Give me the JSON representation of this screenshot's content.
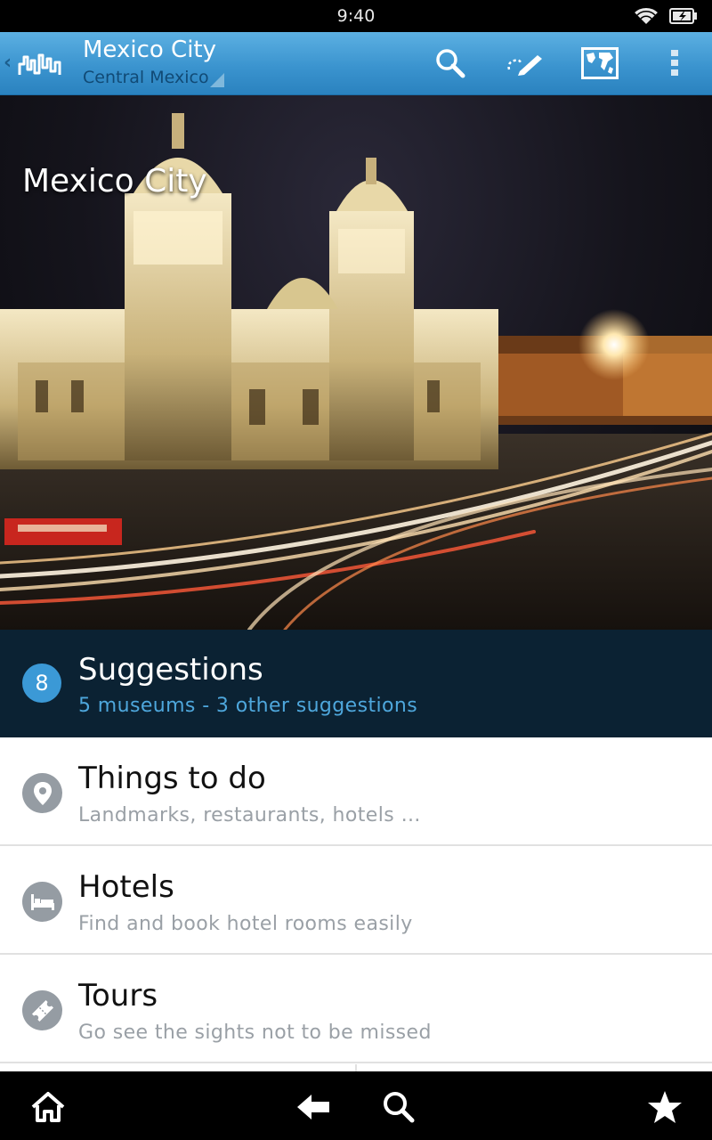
{
  "status_bar": {
    "time": "9:40"
  },
  "action_bar": {
    "title": "Mexico City",
    "subtitle": "Central Mexico",
    "icons": [
      "search-icon",
      "edit-icon",
      "map-icon",
      "overflow-menu-icon"
    ]
  },
  "hero": {
    "title": "Mexico City"
  },
  "list": {
    "suggestions": {
      "count": "8",
      "title": "Suggestions",
      "subtitle": "5 museums - 3 other suggestions"
    },
    "items": [
      {
        "title": "Things to do",
        "subtitle": "Landmarks, restaurants, hotels …",
        "icon": "map-pin-icon"
      },
      {
        "title": "Hotels",
        "subtitle": "Find and book hotel rooms easily",
        "icon": "bed-icon"
      },
      {
        "title": "Tours",
        "subtitle": "Go see the sights not to be missed",
        "icon": "ticket-icon"
      }
    ]
  },
  "nav_bar": {
    "icons": [
      "home-icon",
      "back-icon",
      "search-icon",
      "star-icon"
    ]
  },
  "colors": {
    "action_bar": "#3b94cf",
    "suggestion_bg": "#0b2233",
    "accent": "#3b99d6"
  }
}
